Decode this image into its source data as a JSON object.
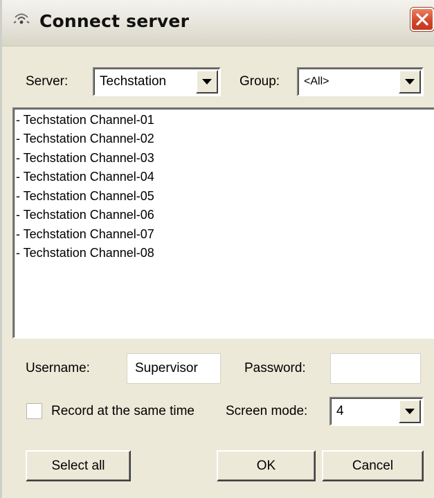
{
  "window": {
    "title": "Connect server"
  },
  "toolbar": {
    "server_label": "Server:",
    "server_value": "Techstation",
    "group_label": "Group:",
    "group_value": "<All>"
  },
  "channels": [
    "- Techstation Channel-01",
    "- Techstation Channel-02",
    "- Techstation Channel-03",
    "- Techstation Channel-04",
    "- Techstation Channel-05",
    "- Techstation Channel-06",
    "- Techstation Channel-07",
    "- Techstation Channel-08"
  ],
  "login": {
    "username_label": "Username:",
    "username_value": "Supervisor",
    "password_label": "Password:",
    "password_value": ""
  },
  "options": {
    "record_label": "Record at the same time",
    "record_checked": false,
    "screen_mode_label": "Screen mode:",
    "screen_mode_value": "4"
  },
  "buttons": {
    "select_all": "Select all",
    "ok": "OK",
    "cancel": "Cancel"
  },
  "colors": {
    "dialog_bg": "#ece9d8",
    "close_button": "#d2452a"
  },
  "icons": {
    "app": "signal-waves-icon",
    "close": "close-icon",
    "dropdown": "chevron-down-icon"
  }
}
